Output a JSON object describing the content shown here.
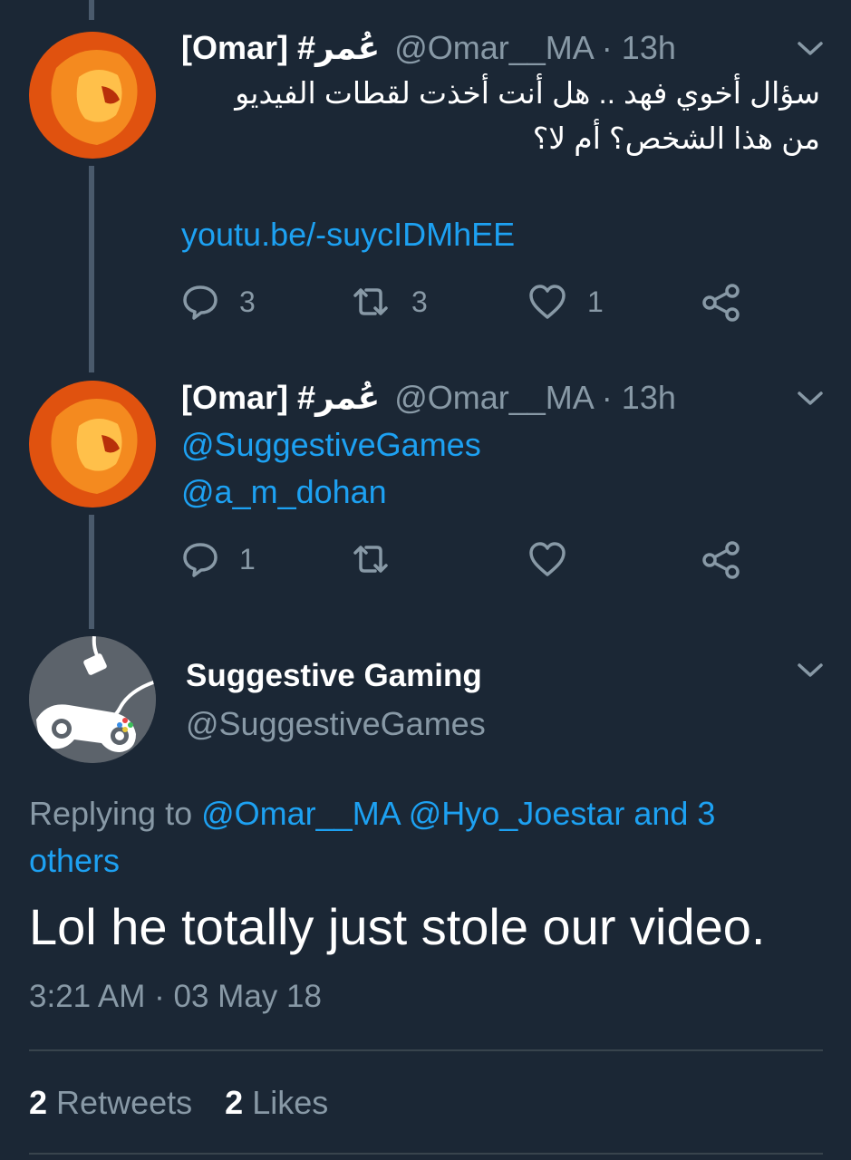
{
  "tweets": [
    {
      "display_name": "[Omar] #عُمر",
      "handle": "@Omar__MA",
      "separator": " · ",
      "time": "13h",
      "text_line1": "سؤال أخوي فهد .. هل أنت أخذت لقطات الفيديو",
      "text_line2": "من هذا الشخص؟ أم لا؟",
      "link": "youtu.be/-suycIDMhEE",
      "replies": "3",
      "retweets": "3",
      "likes": "1"
    },
    {
      "display_name": "[Omar] #عُمر",
      "handle": "@Omar__MA",
      "separator": " · ",
      "time": "13h",
      "mention1": "@SuggestiveGames",
      "mention2": "@a_m_dohan",
      "replies": "1",
      "retweets": "",
      "likes": ""
    }
  ],
  "main_tweet": {
    "display_name": "Suggestive Gaming",
    "handle": "@SuggestiveGames",
    "replying_prefix": "Replying to ",
    "replying_users": "@Omar__MA @Hyo_Joestar and 3 others",
    "text": "Lol he totally just stole our video.",
    "timestamp": "3:21 AM · 03 May 18",
    "retweet_count": "2",
    "retweet_label": "Retweets",
    "like_count": "2",
    "like_label": "Likes"
  },
  "colors": {
    "background": "#1b2735",
    "accent": "#1da1f2",
    "secondary_text": "#8899a6"
  },
  "icons": [
    "reply-icon",
    "retweet-icon",
    "like-icon",
    "share-icon",
    "chevron-down-icon"
  ]
}
